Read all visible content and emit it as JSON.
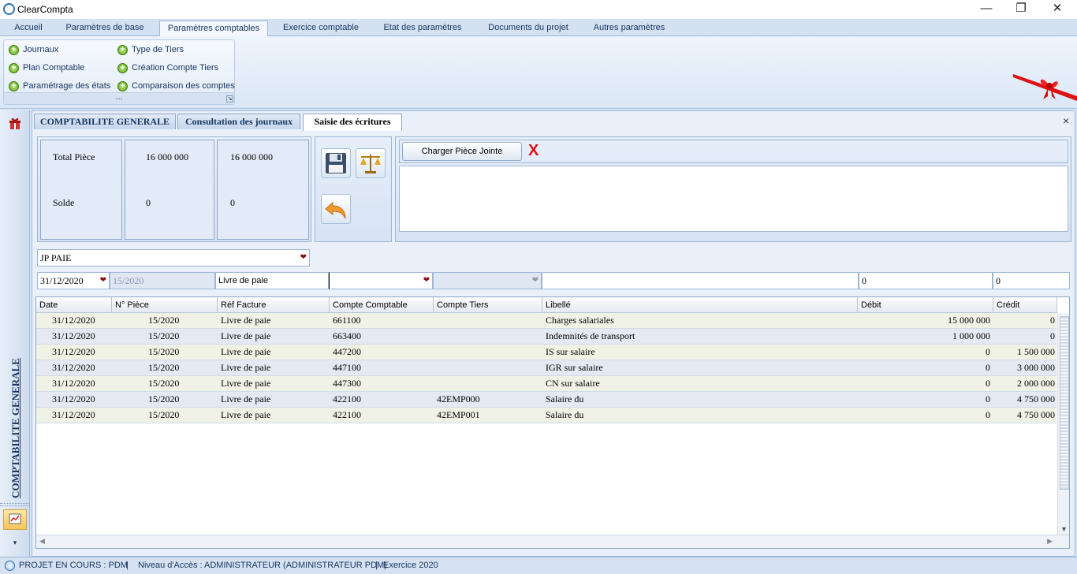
{
  "window": {
    "title": "ClearCompta",
    "minimize": "—",
    "restore": "❐",
    "close": "✕"
  },
  "ribbon_tabs": [
    "Accueil",
    "Paramètres de base",
    "Paramètres comptables",
    "Exercice comptable",
    "Etat des paramètres",
    "Documents du projet",
    "Autres paramètres"
  ],
  "ribbon_group": {
    "items": [
      "Journaux",
      "Type de Tiers",
      "Plan Comptable",
      "Création Compte Tiers",
      "Paramétrage des états",
      "Comparaison des comptes"
    ],
    "footer": "..."
  },
  "sidebar": {
    "label": "COMPTABILITE GENERALE"
  },
  "doc_tabs": [
    "COMPTABILITE GENERALE",
    "Consultation des journaux",
    "Saisie des écritures"
  ],
  "close_symbol": "×",
  "totals": {
    "total_label": "Total Pièce",
    "solde_label": "Solde",
    "debit_total": "16 000 000",
    "credit_total": "16 000 000",
    "debit_solde": "0",
    "credit_solde": "0"
  },
  "attachment": {
    "load_button": "Charger Pièce Jointe",
    "delete_symbol": "X"
  },
  "journal": {
    "value": "JP  PAIE"
  },
  "entry": {
    "date": "31/12/2020",
    "piece": "15/2020",
    "ref": "Livre de paie",
    "compte": "",
    "tiers": "",
    "libelle": "",
    "debit": "0",
    "credit": "0"
  },
  "grid": {
    "columns": [
      "Date",
      "N° Pièce",
      "Réf Facture",
      "Compte Comptable",
      "Compte Tiers",
      "Libellé",
      "Débit",
      "Crédit"
    ],
    "rows": [
      [
        "31/12/2020",
        "15/2020",
        "Livre de paie",
        "661100",
        "",
        "Charges salariales",
        "15 000 000",
        "0"
      ],
      [
        "31/12/2020",
        "15/2020",
        "Livre de paie",
        "663400",
        "",
        "Indemnités de transport",
        "1 000 000",
        "0"
      ],
      [
        "31/12/2020",
        "15/2020",
        "Livre de paie",
        "447200",
        "",
        "IS sur salaire",
        "0",
        "1 500 000"
      ],
      [
        "31/12/2020",
        "15/2020",
        "Livre de paie",
        "447100",
        "",
        "IGR sur salaire",
        "0",
        "3 000 000"
      ],
      [
        "31/12/2020",
        "15/2020",
        "Livre de paie",
        "447300",
        "",
        "CN sur salaire",
        "0",
        "2 000 000"
      ],
      [
        "31/12/2020",
        "15/2020",
        "Livre de paie",
        "422100",
        "42EMP000",
        "Salaire du",
        "0",
        "4 750 000"
      ],
      [
        "31/12/2020",
        "15/2020",
        "Livre de paie",
        "422100",
        "42EMP001",
        "Salaire du",
        "0",
        "4 750 000"
      ]
    ]
  },
  "status": {
    "projet": "PROJET EN COURS : PDM",
    "sep": "|",
    "niveau": "Niveau d'Accès : ADMINISTRATEUR (ADMINISTRATEUR PDM)",
    "exercice": "Exercice 2020"
  },
  "colors": {
    "accent": "#15345e",
    "row_alt": "#e4e9f4",
    "row_base": "#f1f2e6"
  }
}
